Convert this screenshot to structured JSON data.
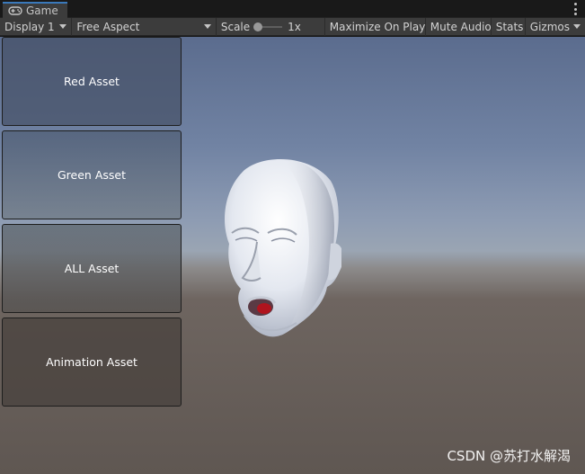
{
  "tab": {
    "title": "Game",
    "icon": "gamepad-icon"
  },
  "toolbar": {
    "display": "Display 1",
    "aspect": "Free Aspect",
    "scale_label": "Scale",
    "scale_value": "1x",
    "maximize": "Maximize On Play",
    "mute": "Mute Audio",
    "stats": "Stats",
    "gizmos": "Gizmos"
  },
  "game": {
    "buttons": [
      {
        "label": "Red Asset"
      },
      {
        "label": "Green Asset"
      },
      {
        "label": "ALL Asset"
      },
      {
        "label": "Animation Asset"
      }
    ]
  },
  "watermark": "CSDN @苏打水解渴"
}
